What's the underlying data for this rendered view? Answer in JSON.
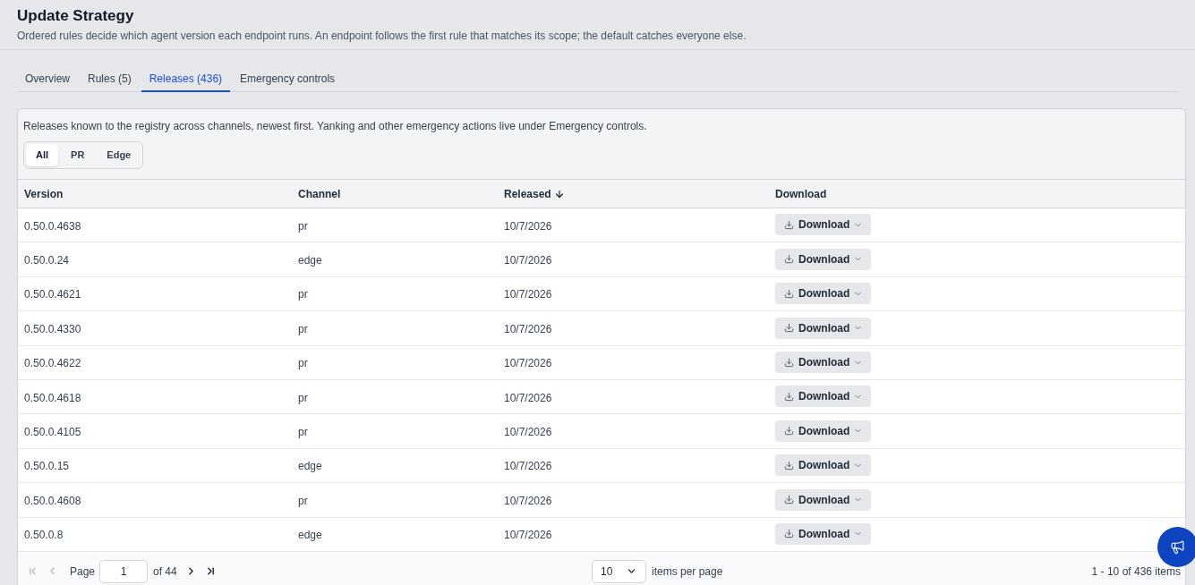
{
  "page": {
    "title": "Update Strategy",
    "description": "Ordered rules decide which agent version each endpoint runs. An endpoint follows the first rule that matches its scope; the default catches everyone else."
  },
  "tabs": [
    {
      "label": "Overview",
      "selected": false
    },
    {
      "label": "Rules (5)",
      "selected": false
    },
    {
      "label": "Releases (436)",
      "selected": true
    },
    {
      "label": "Emergency controls",
      "selected": false
    }
  ],
  "releases": {
    "description": "Releases known to the registry across channels, newest first. Yanking and other emergency actions live under Emergency controls.",
    "filters": [
      {
        "label": "All",
        "selected": true
      },
      {
        "label": "PR",
        "selected": false
      },
      {
        "label": "Edge",
        "selected": false
      }
    ],
    "table": {
      "columns": [
        {
          "label": "Version",
          "sorted": false
        },
        {
          "label": "Channel",
          "sorted": false
        },
        {
          "label": "Released",
          "sorted": true
        },
        {
          "label": "Download",
          "sorted": false
        }
      ],
      "rows": [
        {
          "version": "0.50.0.4638",
          "channel": "pr",
          "released": "10/7/2026",
          "download": "Download"
        },
        {
          "version": "0.50.0.24",
          "channel": "edge",
          "released": "10/7/2026",
          "download": "Download"
        },
        {
          "version": "0.50.0.4621",
          "channel": "pr",
          "released": "10/7/2026",
          "download": "Download"
        },
        {
          "version": "0.50.0.4330",
          "channel": "pr",
          "released": "10/7/2026",
          "download": "Download"
        },
        {
          "version": "0.50.0.4622",
          "channel": "pr",
          "released": "10/7/2026",
          "download": "Download"
        },
        {
          "version": "0.50.0.4618",
          "channel": "pr",
          "released": "10/7/2026",
          "download": "Download"
        },
        {
          "version": "0.50.0.4105",
          "channel": "pr",
          "released": "10/7/2026",
          "download": "Download"
        },
        {
          "version": "0.50.0.15",
          "channel": "edge",
          "released": "10/7/2026",
          "download": "Download"
        },
        {
          "version": "0.50.0.4608",
          "channel": "pr",
          "released": "10/7/2026",
          "download": "Download"
        },
        {
          "version": "0.50.0.8",
          "channel": "edge",
          "released": "10/7/2026",
          "download": "Download"
        }
      ]
    },
    "pagination": {
      "back": [
        {
          "kind": "first",
          "disabled": true
        },
        {
          "kind": "previous",
          "disabled": true
        }
      ],
      "page_label": "Page",
      "page": "1",
      "page_count": "of 44",
      "forward": [
        {
          "kind": "next",
          "disabled": false
        },
        {
          "kind": "last",
          "disabled": false
        }
      ],
      "page_size": "10",
      "page_size_label": "items per page",
      "range": "1 - 10 of 436 items"
    }
  }
}
